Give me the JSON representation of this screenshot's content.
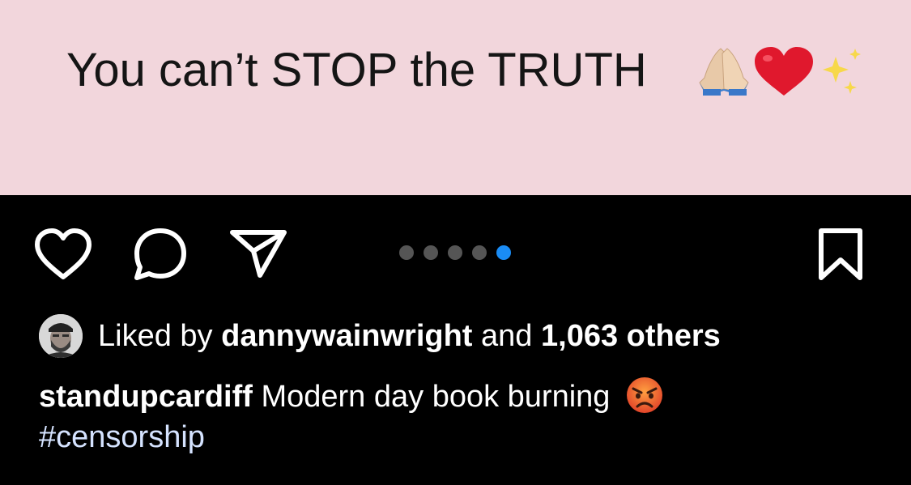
{
  "post": {
    "image_text": "You can’t STOP the TRUTH",
    "image_emojis": [
      "folded-hands",
      "red-heart",
      "sparkles"
    ],
    "image_background": "#f2d6dc"
  },
  "actions": {
    "like_icon": "heart-icon",
    "comment_icon": "comment-icon",
    "share_icon": "paper-plane-icon",
    "save_icon": "bookmark-icon",
    "carousel": {
      "total": 5,
      "active": 5,
      "active_color": "#1a8cf5"
    }
  },
  "likes": {
    "prefix": "Liked by",
    "user": "dannywainwright",
    "conjunction": "and",
    "others": "1,063 others"
  },
  "caption": {
    "username": "standupcardiff",
    "text": "Modern day book burning",
    "emoji": "angry-face",
    "hashtag": "#censorship"
  }
}
